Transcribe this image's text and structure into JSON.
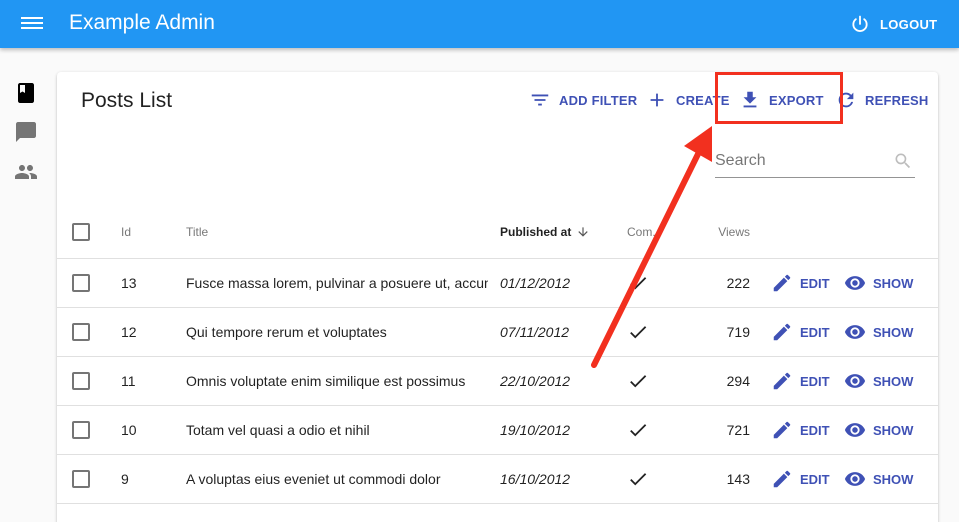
{
  "appbar": {
    "title": "Example Admin",
    "menu_icon": "menu-icon",
    "logout_label": "LOGOUT",
    "color": "#2196f3"
  },
  "sidebar": {
    "items": [
      {
        "icon": "book-icon"
      },
      {
        "icon": "comment-icon"
      },
      {
        "icon": "people-icon"
      }
    ]
  },
  "list": {
    "title": "Posts List",
    "actions": {
      "add_filter": "ADD FILTER",
      "create": "CREATE",
      "export": "EXPORT",
      "refresh": "REFRESH"
    },
    "search_placeholder": "Search",
    "accent": "#3f51b5",
    "columns": {
      "id": "Id",
      "title": "Title",
      "published_at": "Published at",
      "commentable": "Com.",
      "views": "Views"
    },
    "rows": [
      {
        "id": "13",
        "title": "Fusce massa lorem, pulvinar a posuere ut, accumsan ac nisi",
        "published_at": "01/12/2012",
        "commentable": true,
        "views": "222",
        "edit": "EDIT",
        "show": "SHOW"
      },
      {
        "id": "12",
        "title": "Qui tempore rerum et voluptates",
        "published_at": "07/11/2012",
        "commentable": true,
        "views": "719",
        "edit": "EDIT",
        "show": "SHOW"
      },
      {
        "id": "11",
        "title": "Omnis voluptate enim similique est possimus",
        "published_at": "22/10/2012",
        "commentable": true,
        "views": "294",
        "edit": "EDIT",
        "show": "SHOW"
      },
      {
        "id": "10",
        "title": "Totam vel quasi a odio et nihil",
        "published_at": "19/10/2012",
        "commentable": true,
        "views": "721",
        "edit": "EDIT",
        "show": "SHOW"
      },
      {
        "id": "9",
        "title": "A voluptas eius eveniet ut commodi dolor",
        "published_at": "16/10/2012",
        "commentable": true,
        "views": "143",
        "edit": "EDIT",
        "show": "SHOW"
      }
    ]
  },
  "annotation": {
    "color": "#f2301f"
  }
}
